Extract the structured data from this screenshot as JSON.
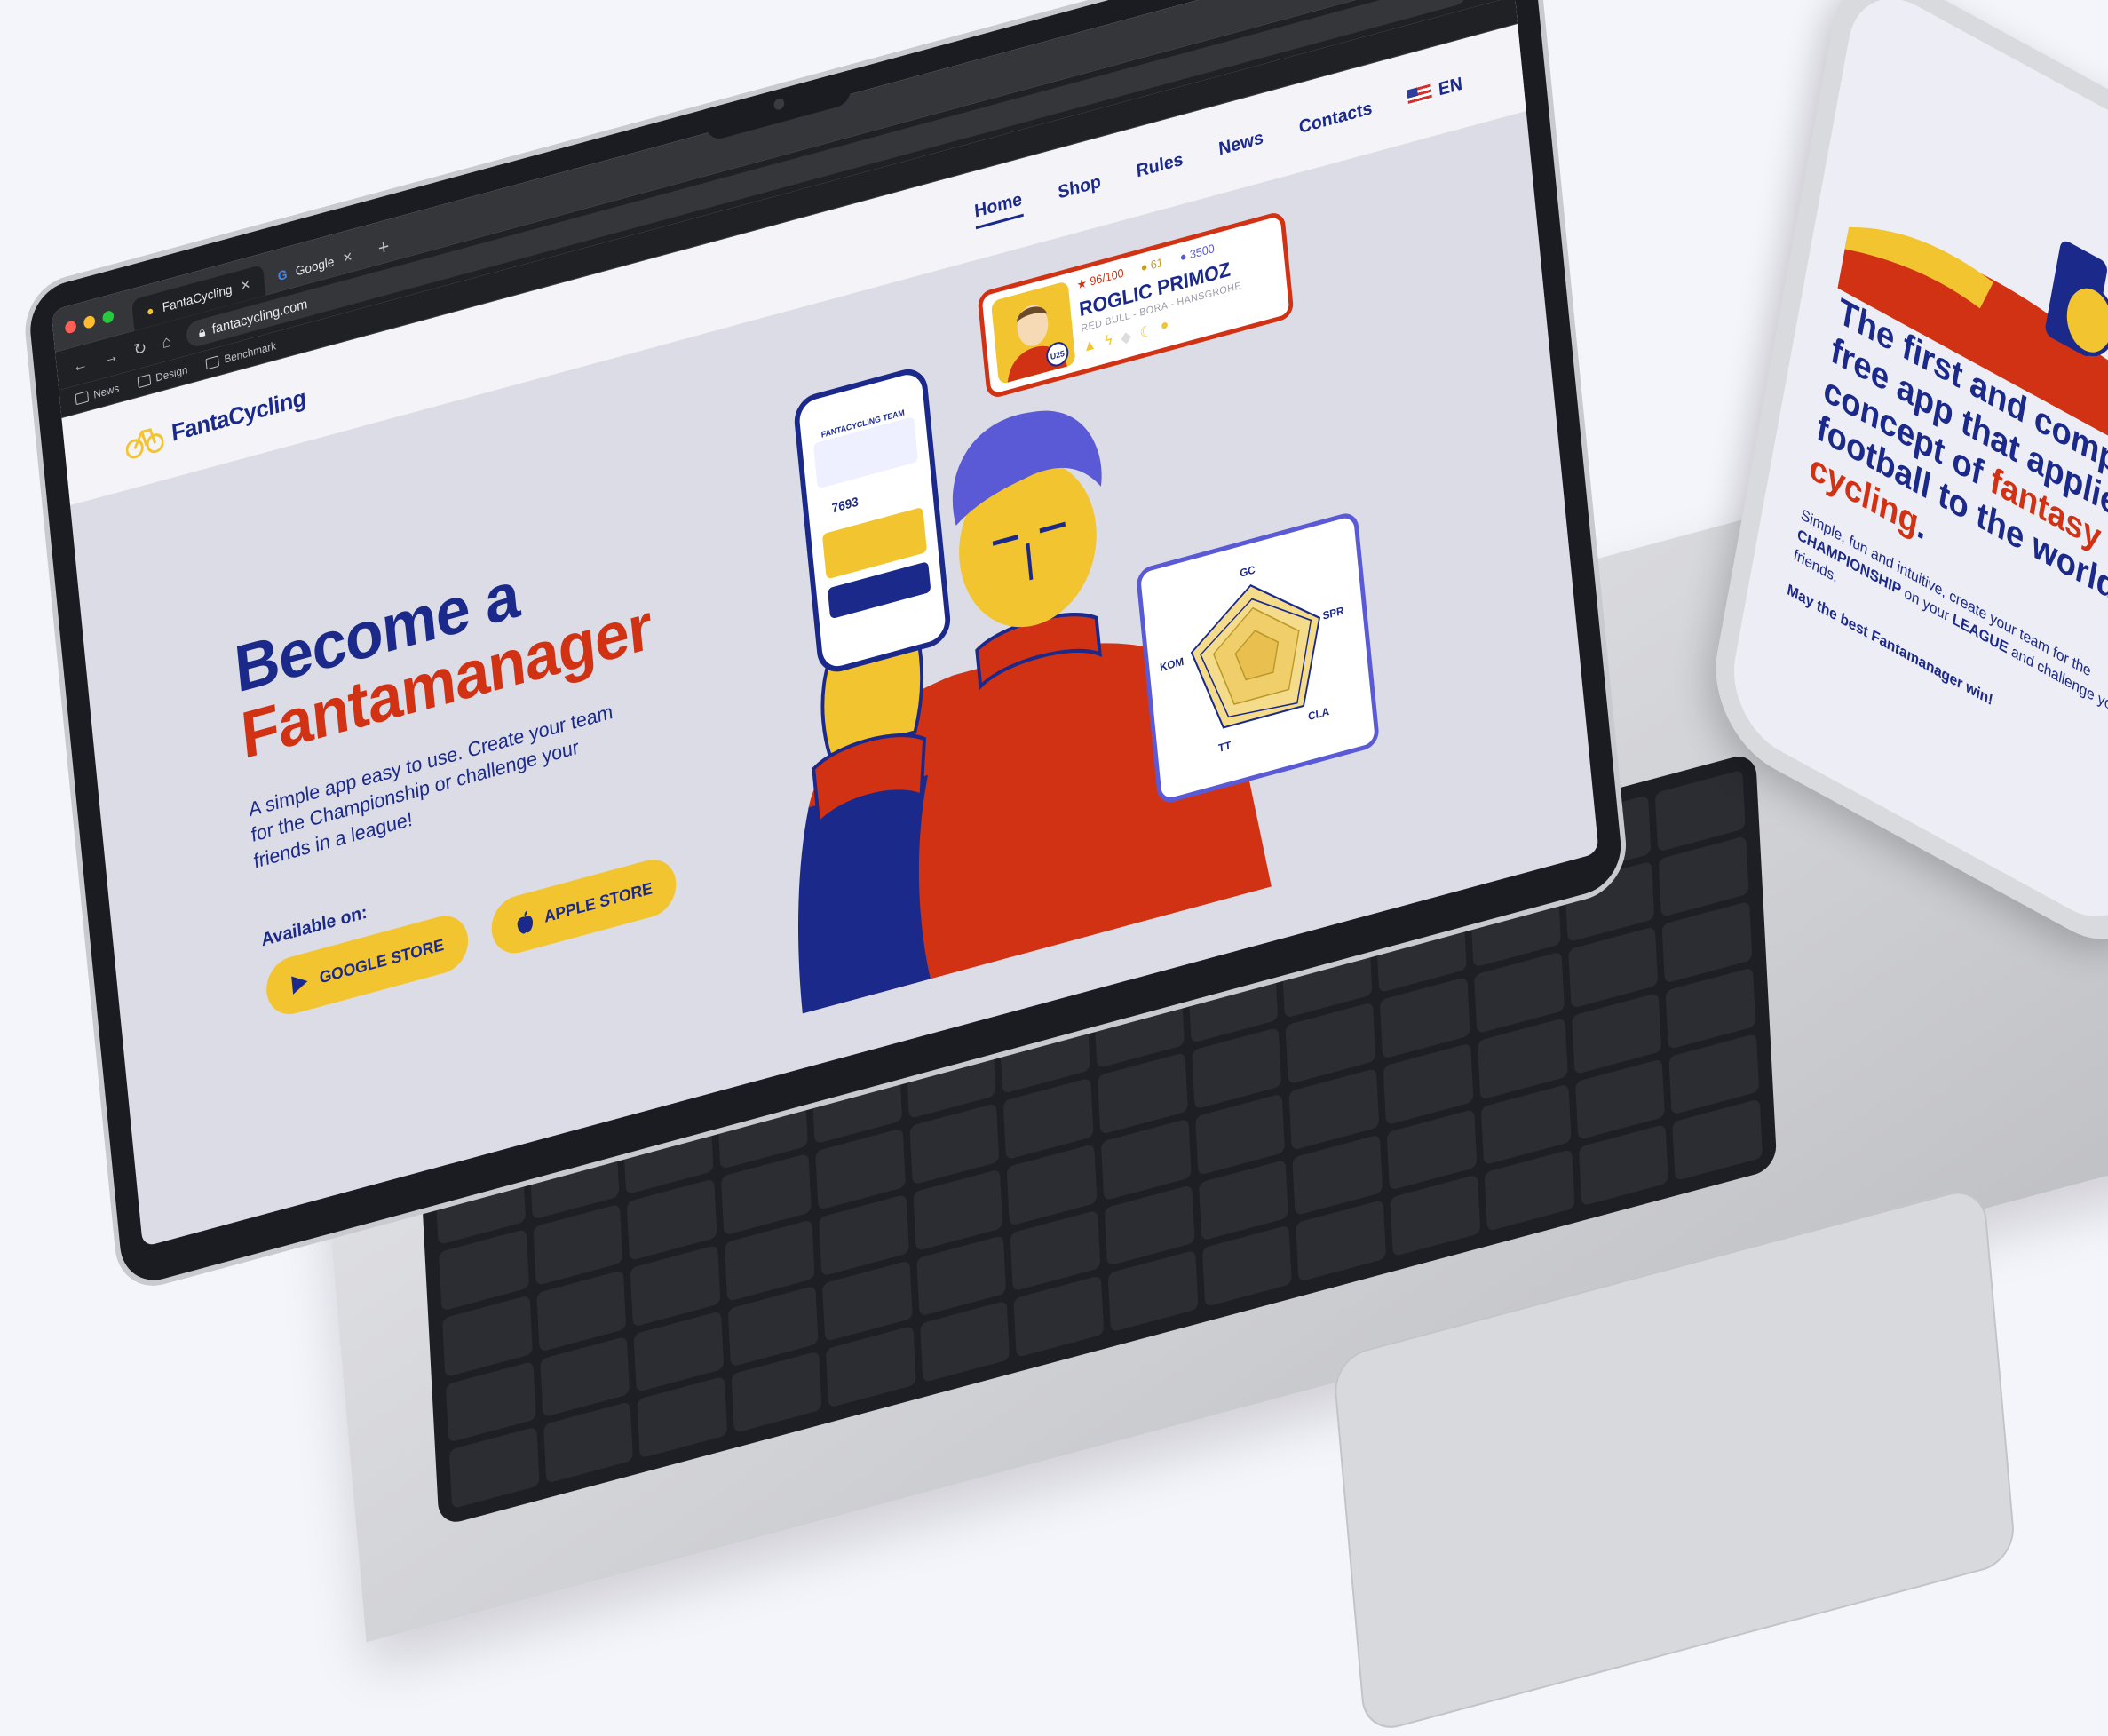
{
  "browser": {
    "tabs": [
      {
        "label": "FantaCycling",
        "active": true
      },
      {
        "label": "Google",
        "active": false
      }
    ],
    "url": "fantacycling.com",
    "bookmarks": [
      "News",
      "Design",
      "Benchmark"
    ]
  },
  "site": {
    "brand": "FantaCycling",
    "nav": [
      {
        "label": "Home",
        "active": true
      },
      {
        "label": "Shop",
        "active": false
      },
      {
        "label": "Rules",
        "active": false
      },
      {
        "label": "News",
        "active": false
      },
      {
        "label": "Contacts",
        "active": false
      }
    ],
    "language": "EN",
    "hero": {
      "title_line1": "Become a",
      "title_line2": "Fantamanager",
      "subtitle": "A simple app easy to use. Create your team for the Championship or challenge your friends in a league!",
      "available_label": "Available on:",
      "google_store_label": "GOOGLE STORE",
      "apple_store_label": "APPLE STORE"
    },
    "rider_card": {
      "score": "96/100",
      "coins": "61",
      "points": "3500",
      "name": "ROGLIC PRIMOZ",
      "team": "RED BULL - BORA - HANSGROHE",
      "badge": "U25"
    },
    "phone_mock": {
      "title": "FANTACYCLING TEAM",
      "value": "7693"
    },
    "radar": {
      "axes": [
        "GC",
        "SPR",
        "CLA",
        "TT",
        "KOM"
      ]
    }
  },
  "phone": {
    "heading_part1": "The first and completely free app that applies the concept of",
    "heading_red1": "fantasy",
    "heading_part2": "football to the world of",
    "heading_red2": "cycling",
    "heading_end": ".",
    "sub_part1": "Simple, fun and intuitive, create your team for the",
    "sub_bold1": "CHAMPIONSHIP",
    "sub_part2": "on your",
    "sub_bold2": "LEAGUE",
    "sub_part3": "and challenge your friends.",
    "win": "May the best Fantamanager win!"
  },
  "colors": {
    "brand_blue": "#1b2a8a",
    "brand_red": "#d13214",
    "brand_yellow": "#f2c530",
    "accent_purple": "#5a5ad6"
  }
}
